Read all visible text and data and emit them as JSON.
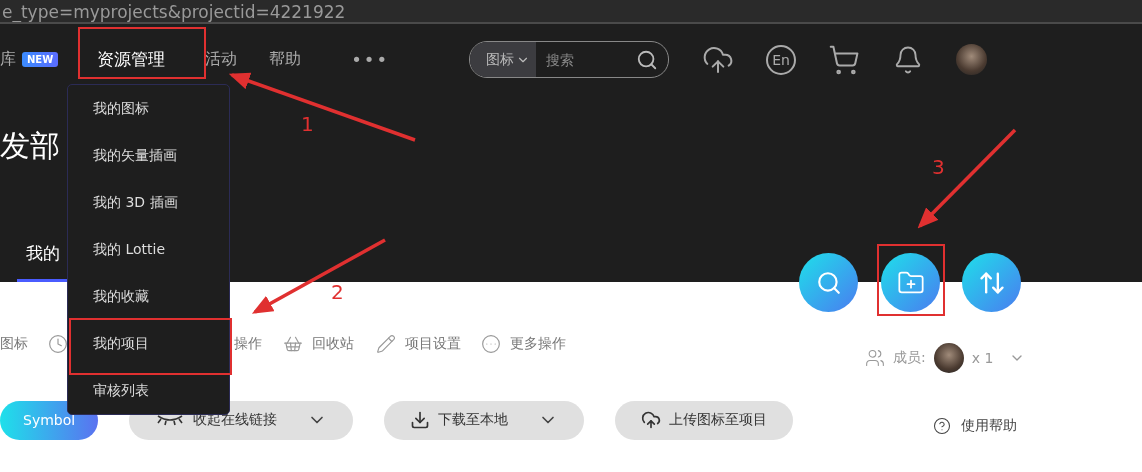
{
  "address_bar": {
    "url": "e_type=myprojects&projectid=4221922"
  },
  "nav": {
    "items": [
      {
        "label": "库",
        "badge": "NEW",
        "selected": false
      },
      {
        "label": "资源管理",
        "selected": true
      },
      {
        "label": "活动",
        "selected": false
      },
      {
        "label": "帮助",
        "selected": false
      }
    ],
    "more": "•••",
    "search": {
      "scope": "图标",
      "placeholder": "搜索"
    },
    "language": "En"
  },
  "header": {
    "title": "发部",
    "tabs": [
      {
        "label": "我的",
        "selected": true
      }
    ]
  },
  "fab": [
    {
      "kind": "search"
    },
    {
      "kind": "add-folder"
    },
    {
      "kind": "sort"
    }
  ],
  "toolbar": [
    {
      "kind": "plain",
      "label": "图标"
    },
    {
      "kind": "clock"
    },
    {
      "kind": "plain",
      "label": "操作"
    },
    {
      "kind": "basket",
      "label": "回收站"
    },
    {
      "kind": "pencil",
      "label": "项目设置"
    },
    {
      "kind": "more",
      "label": "更多操作"
    }
  ],
  "members": {
    "label": "成员:",
    "count": "x 1"
  },
  "actions": [
    {
      "kind": "primary",
      "label": "Symbol"
    },
    {
      "kind": "eye",
      "label": "收起在线链接",
      "dropdown": true
    },
    {
      "kind": "download",
      "label": "下载至本地",
      "dropdown": true
    },
    {
      "kind": "upload",
      "label": "上传图标至项目",
      "dropdown": false
    }
  ],
  "help": "使用帮助",
  "dropdown": {
    "items": [
      "我的图标",
      "我的矢量插画",
      "我的 3D 插画",
      "我的 Lottie",
      "我的收藏",
      "我的项目",
      "审核列表"
    ]
  },
  "annotations": {
    "labels": [
      "1",
      "2",
      "3"
    ]
  }
}
